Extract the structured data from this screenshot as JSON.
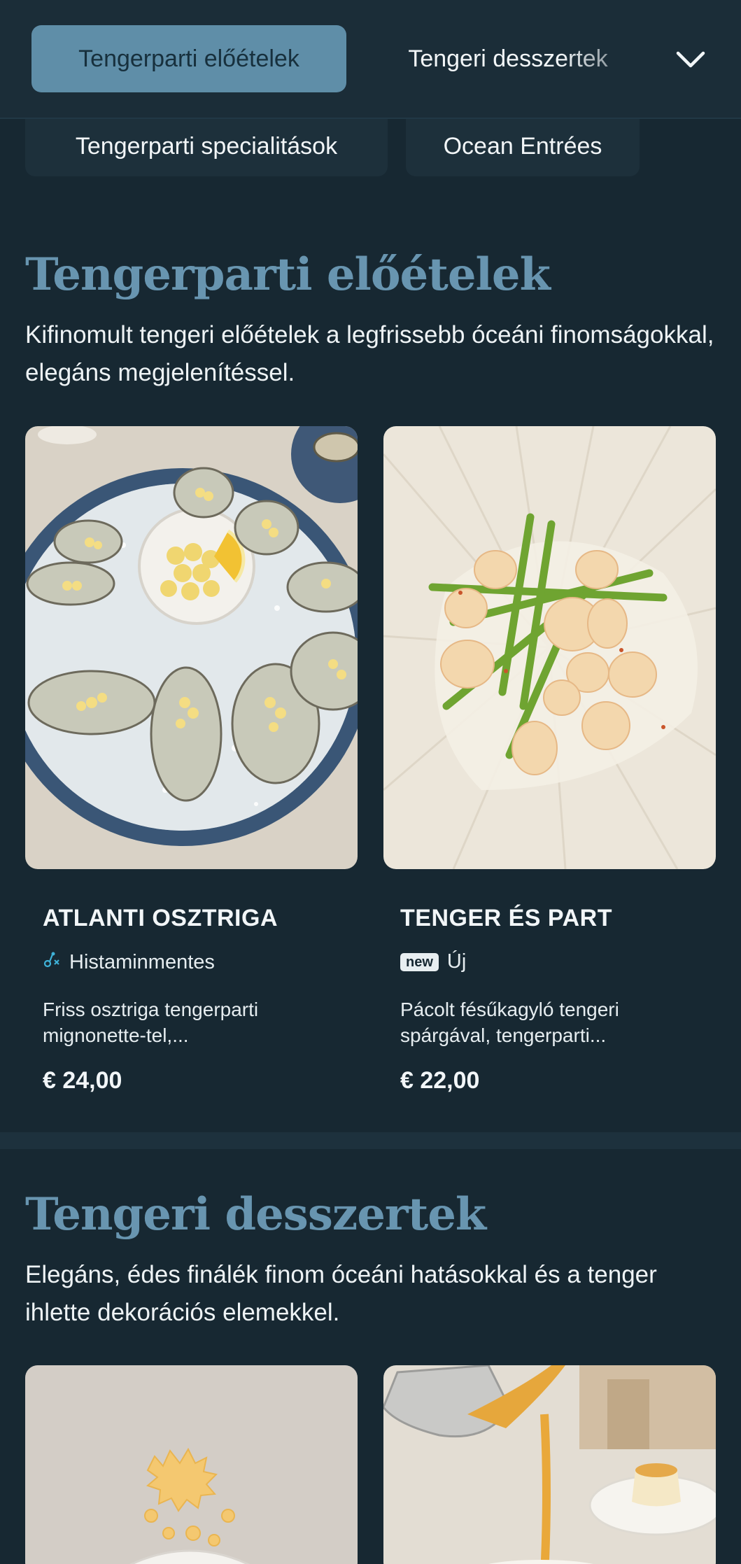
{
  "topbar": {
    "active_category": "Tengerparti előételek",
    "next_category": "Tengeri desszertek",
    "expand_icon": "chevron-down-icon"
  },
  "category_chips": [
    "Tengerparti specialitások",
    "Ocean Entrées"
  ],
  "sections": [
    {
      "title": "Tengerparti előételek",
      "description": "Kifinomult tengeri előételek a legfrissebb óceáni finomságokkal, elegáns megjelenítéssel.",
      "items": [
        {
          "name": "ATLANTI OSZTRIGA",
          "tag": "Histaminmentes",
          "tag_icon": "histamine-free-icon",
          "description": "Friss osztriga tengerparti mignonette-tel,...",
          "price": "€ 24,00"
        },
        {
          "name": "TENGER ÉS PART",
          "badge": "new",
          "tag": "Új",
          "description": "Pácolt fésűkagyló tengeri spárgával, tengerparti...",
          "price": "€ 22,00"
        }
      ]
    },
    {
      "title": "Tengeri desszertek",
      "description": "Elegáns, édes finálék finom óceáni hatásokkal és a tenger ihlette dekorációs elemekkel."
    }
  ],
  "colors": {
    "background": "#172832",
    "accent": "#5f8ea8",
    "title": "#6895b0"
  }
}
